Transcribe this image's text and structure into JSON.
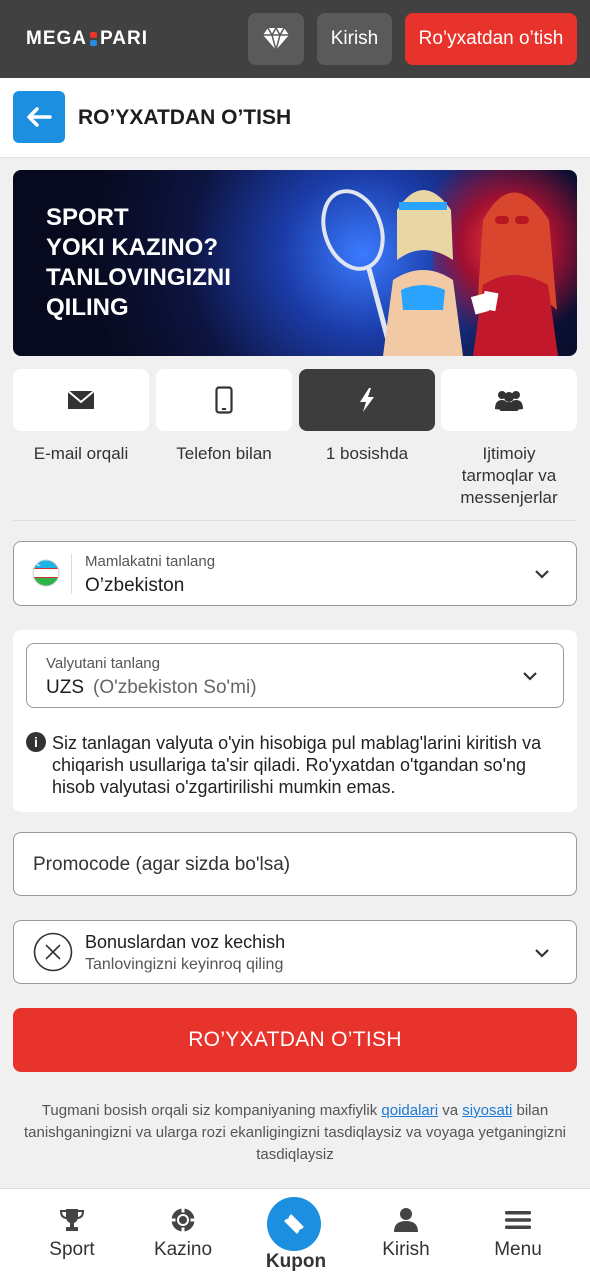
{
  "header": {
    "logo_left": "MEGA",
    "logo_right": "PARI",
    "login_label": "Kirish",
    "register_label": "Ro’yxatdan o’tish"
  },
  "titlebar": {
    "title": "RO’YXATDAN O’TISH"
  },
  "banner": {
    "line1": "SPORT",
    "line2": "YOKI KAZINO?",
    "line3": "TANLOVINGIZNI",
    "line4": "QILING"
  },
  "reg_types": [
    {
      "label": "E-mail orqali",
      "icon": "envelope-icon",
      "active": false
    },
    {
      "label": "Telefon bilan",
      "icon": "phone-icon",
      "active": false
    },
    {
      "label": "1 bosishda",
      "icon": "lightning-icon",
      "active": true
    },
    {
      "label": "Ijtimoiy tarmoqlar va messenjerlar",
      "icon": "users-icon",
      "active": false
    }
  ],
  "country": {
    "label": "Mamlakatni tanlang",
    "value": "O’zbekiston",
    "flag": "uzbekistan-flag"
  },
  "currency": {
    "label": "Valyutani tanlang",
    "code": "UZS",
    "name": "(O'zbekiston So'mi)",
    "info": "Siz tanlagan valyuta o'yin hisobiga pul mablag'larini kiritish va chiqarish usullariga ta'sir qiladi. Ro'yxatdan o'tgandan so'ng hisob valyutasi o'zgartirilishi mumkin emas."
  },
  "promo": {
    "placeholder": "Promocode (agar sizda bo'lsa)"
  },
  "bonus": {
    "title": "Bonuslardan voz kechish",
    "subtitle": "Tanlovingizni keyinroq qiling"
  },
  "submit_label": "RO’YXATDAN O’TISH",
  "terms": {
    "part1": "Tugmani bosish orqali siz kompaniyaning maxfiylik ",
    "link1": "qoidalari",
    "part2": " va ",
    "link2": "siyosati",
    "part3": " bilan tanishganingizni va ularga rozi ekanligingizni tasdiqlaysiz va voyaga yetganingizni tasdiqlaysiz"
  },
  "bottom_nav": {
    "sport": "Sport",
    "kazino": "Kazino",
    "kupon": "Kupon",
    "kirish": "Kirish",
    "menu": "Menu"
  },
  "colors": {
    "accent_red": "#e8322c",
    "accent_blue": "#1d8fe1",
    "header_bg": "#414141"
  }
}
